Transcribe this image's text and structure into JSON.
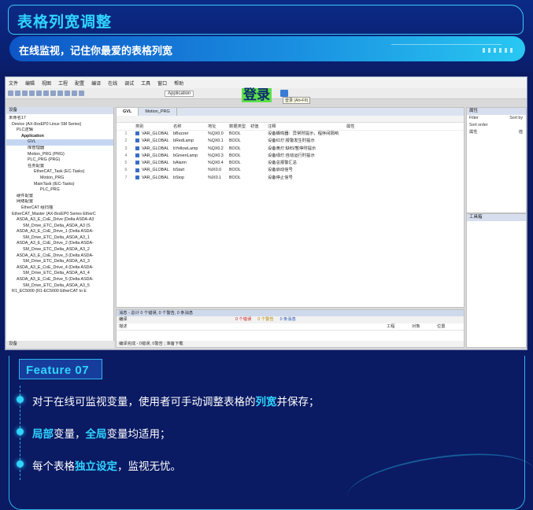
{
  "header": {
    "title": "表格列宽调整",
    "subtitle": "在线监视，记住你最爱的表格列宽"
  },
  "ide": {
    "menu": [
      "文件",
      "编辑",
      "视图",
      "工程",
      "配置",
      "编译",
      "在线",
      "调试",
      "工具",
      "窗口",
      "帮助"
    ],
    "application_box": "Application",
    "login_label": "登录",
    "login_tooltip": "登录 (Alt+F8)",
    "devices_panel_title": "设备",
    "tree": [
      "未命名17",
      "Device (AX-8xxEP0 Linux SM Series)",
      "PLC逻辑",
      "Application",
      "GVL",
      "库管理器",
      "Motion_PRG (PRG)",
      "PLC_PRG (PRG)",
      "任务配置",
      "EtherCAT_Task (EC-Tasks)",
      "Motion_PRG",
      "MainTask (IEC-Tasks)",
      "PLC_PRG",
      "硬件配置",
      "网络配置",
      "EtherCAT 组扫描",
      "EtherCAT_Master (AX-8xxEP0 Series EtherC",
      "ASDA_A3_E_CoE_Drive (Delta ASDA-A3",
      "SM_Drive_ETC_Delta_ASDA_A3 (S",
      "ASDA_A3_E_CoE_Drive_1 (Delta ASDA-",
      "SM_Drive_ETC_Delta_ASDA_A3_1",
      "ASDA_A3_E_CoE_Drive_2 (Delta ASDA-",
      "SM_Drive_ETC_Delta_ASDA_A3_2",
      "ASDA_A3_E_CoE_Drive_3 (Delta ASDA-",
      "SM_Drive_ETC_Delta_ASDA_A3_3",
      "ASDA_A3_E_CoE_Drive_4 (Delta ASDA-",
      "SM_Drive_ETC_Delta_ASDA_A3_4",
      "ASDA_A3_E_CoE_Drive_5 (Delta ASDA-",
      "SM_Drive_ETC_Delta_ASDA_A3_5",
      "R1_EC5000 (R1-EC5000 EtherCAT to E"
    ],
    "devices_footer": "设备",
    "tabs": [
      "GVL",
      "Motion_PRG"
    ],
    "columns": [
      "",
      "类别",
      "名称",
      "地址",
      "数据类型",
      "初值",
      "注释",
      "属性"
    ],
    "rows": [
      {
        "n": "1",
        "cat": "VAR_GLOBAL",
        "name": "bBuzzer",
        "addr": "%QX0.0",
        "type": "BOOL",
        "init": "",
        "comment": "设备蜂鸣器：异常时提示，程序间隔响"
      },
      {
        "n": "2",
        "cat": "VAR_GLOBAL",
        "name": "bRedLamp",
        "addr": "%QX0.1",
        "type": "BOOL",
        "init": "",
        "comment": "设备红灯:报警发生时提示"
      },
      {
        "n": "3",
        "cat": "VAR_GLOBAL",
        "name": "bYellowLamp",
        "addr": "%QX0.2",
        "type": "BOOL",
        "init": "",
        "comment": "设备黄灯:缺料/暂停时提示"
      },
      {
        "n": "4",
        "cat": "VAR_GLOBAL",
        "name": "bGreenLamp",
        "addr": "%QX0.3",
        "type": "BOOL",
        "init": "",
        "comment": "设备绿灯:自动运行时提示"
      },
      {
        "n": "5",
        "cat": "VAR_GLOBAL",
        "name": "bAlarm",
        "addr": "%QX0.4",
        "type": "BOOL",
        "init": "",
        "comment": "设备总报警汇总"
      },
      {
        "n": "6",
        "cat": "VAR_GLOBAL",
        "name": "bStart",
        "addr": "%IX0.0",
        "type": "BOOL",
        "init": "",
        "comment": "设备启动信号"
      },
      {
        "n": "7",
        "cat": "VAR_GLOBAL",
        "name": "bStop",
        "addr": "%IX0.1",
        "type": "BOOL",
        "init": "",
        "comment": "设备停止信号"
      }
    ],
    "messages": {
      "title": "消息 - 总计 0 个错误, 0 个警告, 0 条消息",
      "source": "编译",
      "errors": "0 个错误",
      "warnings": "0 个警告",
      "infos": "0 条消息",
      "col_desc": "描述",
      "col_project": "工程",
      "col_object": "对象",
      "col_pos": "位置",
      "footer": "编译完成 - 0错误, 0警告 ; 准备下载"
    },
    "properties_title": "属性",
    "filter_label": "Filter",
    "sort_by": "Sort by",
    "sort_order": "Sort order",
    "prop_col1": "属性",
    "prop_col2": "值",
    "toolbox_title": "工具箱"
  },
  "feature": {
    "label": "Feature 07",
    "bullet1_pre": "对于在线可监视变量，使用者可手动调整表格的",
    "bullet1_accent": "列宽",
    "bullet1_post": "并保存；",
    "bullet2_accent1": "局部",
    "bullet2_mid": "变量，",
    "bullet2_accent2": "全局",
    "bullet2_post": "变量均适用；",
    "bullet3_pre": "每个表格",
    "bullet3_accent": "独立设定",
    "bullet3_post": "，监视无忧。"
  }
}
